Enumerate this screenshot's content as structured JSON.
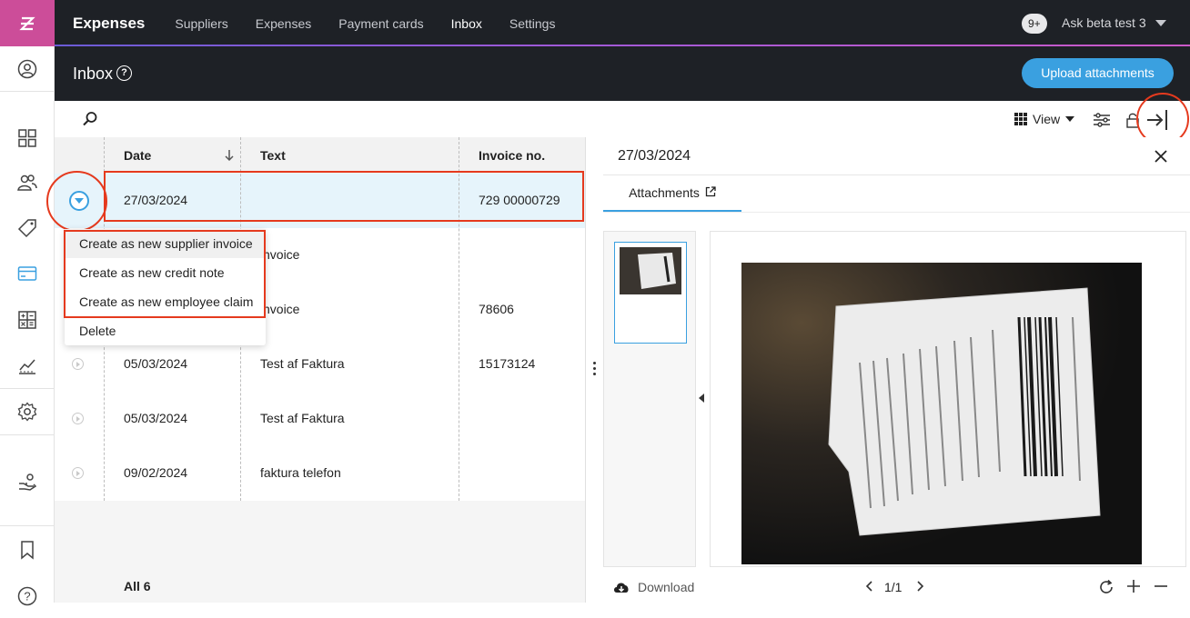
{
  "app": {
    "brand": "Expenses"
  },
  "nav": [
    {
      "label": "Suppliers",
      "active": false
    },
    {
      "label": "Expenses",
      "active": false
    },
    {
      "label": "Payment cards",
      "active": false
    },
    {
      "label": "Inbox",
      "active": true
    },
    {
      "label": "Settings",
      "active": false
    }
  ],
  "account": {
    "badge": "9+",
    "user": "Ask beta test 3"
  },
  "page": {
    "title": "Inbox",
    "help_glyph": "?",
    "upload_label": "Upload attachments"
  },
  "toolbar": {
    "view_label": "View"
  },
  "table": {
    "headers": {
      "date": "Date",
      "text": "Text",
      "invoice": "Invoice no."
    },
    "rows": [
      {
        "date": "27/03/2024",
        "text": "",
        "invoice": "729 00000729"
      },
      {
        "date": "",
        "text": "nvoice",
        "invoice": ""
      },
      {
        "date": "",
        "text": "nvoice",
        "invoice": "78606"
      },
      {
        "date": "05/03/2024",
        "text": "Test af Faktura",
        "invoice": "15173124"
      },
      {
        "date": "05/03/2024",
        "text": "Test af Faktura",
        "invoice": ""
      },
      {
        "date": "09/02/2024",
        "text": "faktura telefon",
        "invoice": ""
      }
    ],
    "footer": "All 6"
  },
  "menu": {
    "items": [
      "Create as new supplier invoice",
      "Create as new credit note",
      "Create as new employee claim",
      "Delete"
    ]
  },
  "panel": {
    "date": "27/03/2024",
    "tab": "Attachments",
    "download_label": "Download",
    "pager": "1/1"
  },
  "colors": {
    "accent": "#3aa0e0",
    "brand": "#cc4d99",
    "annotation": "#e53a1e",
    "dark": "#1e2126"
  }
}
